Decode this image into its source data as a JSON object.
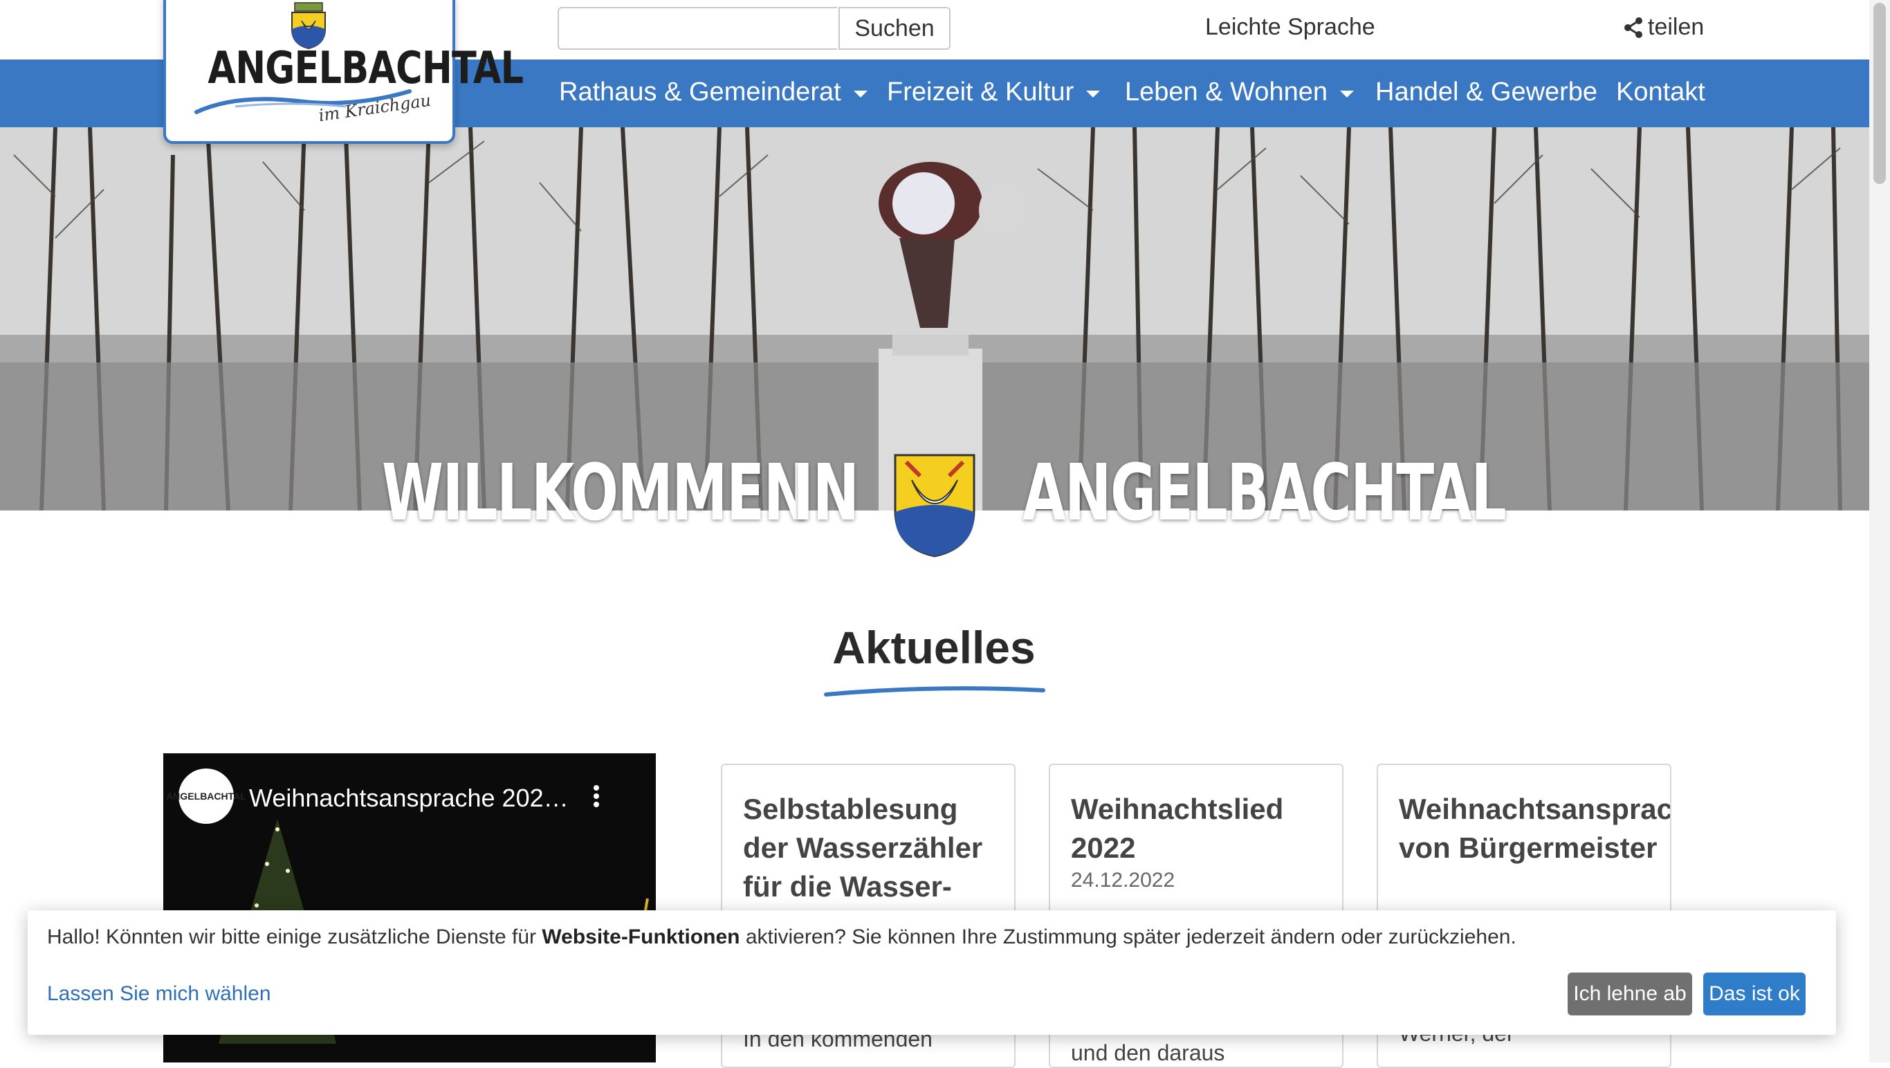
{
  "logo": {
    "name": "ANGELBACHTAL",
    "sub": "im Kraichgau"
  },
  "search": {
    "placeholder": "",
    "button_label": "Suchen"
  },
  "top_links": {
    "easy_language": "Leichte Sprache",
    "share": "teilen"
  },
  "nav": [
    {
      "label": "Rathaus & Gemeinderat",
      "dropdown": true
    },
    {
      "label": "Freizeit & Kultur",
      "dropdown": true
    },
    {
      "label": "Leben & Wohnen",
      "dropdown": true
    },
    {
      "label": "Handel & Gewerbe",
      "dropdown": false
    },
    {
      "label": "Kontakt",
      "dropdown": false
    }
  ],
  "hero": {
    "word1": "WILLKOMMEN",
    "word2": "IN",
    "word3": "ANGELBACHTAL"
  },
  "news": {
    "section_title": "Aktuelles",
    "video": {
      "title": "Weihnachtsansprache 202…",
      "channel": "ANGELBACHTAL"
    },
    "cards": [
      {
        "title": "Selbstablesung der Wasserzähler für die Wasser- und",
        "date": "",
        "excerpt": "In den kommenden"
      },
      {
        "title": "Weihnachtslied 2022",
        "date": "24.12.2022",
        "excerpt": "und den daraus"
      },
      {
        "title": "Weihnachtsansprache von Bürgermeister",
        "date": "",
        "excerpt": "Werner, der"
      }
    ]
  },
  "cookie": {
    "text_before": "Hallo! Könnten wir bitte einige zusätzliche Dienste für ",
    "text_bold": "Website-Funktionen",
    "text_after": " aktivieren? Sie können Ihre Zustimmung später jederzeit ändern oder zurückziehen.",
    "choose_link": "Lassen Sie mich wählen",
    "decline_label": "Ich lehne ab",
    "accept_label": "Das ist ok"
  },
  "colors": {
    "brand_blue": "#3a78c3",
    "decline_gray": "#707070",
    "accept_blue": "#2f7cc9"
  },
  "icons": {
    "share": "share-icon",
    "video_menu": "kebab-menu-icon",
    "dropdown": "caret-down-icon"
  }
}
